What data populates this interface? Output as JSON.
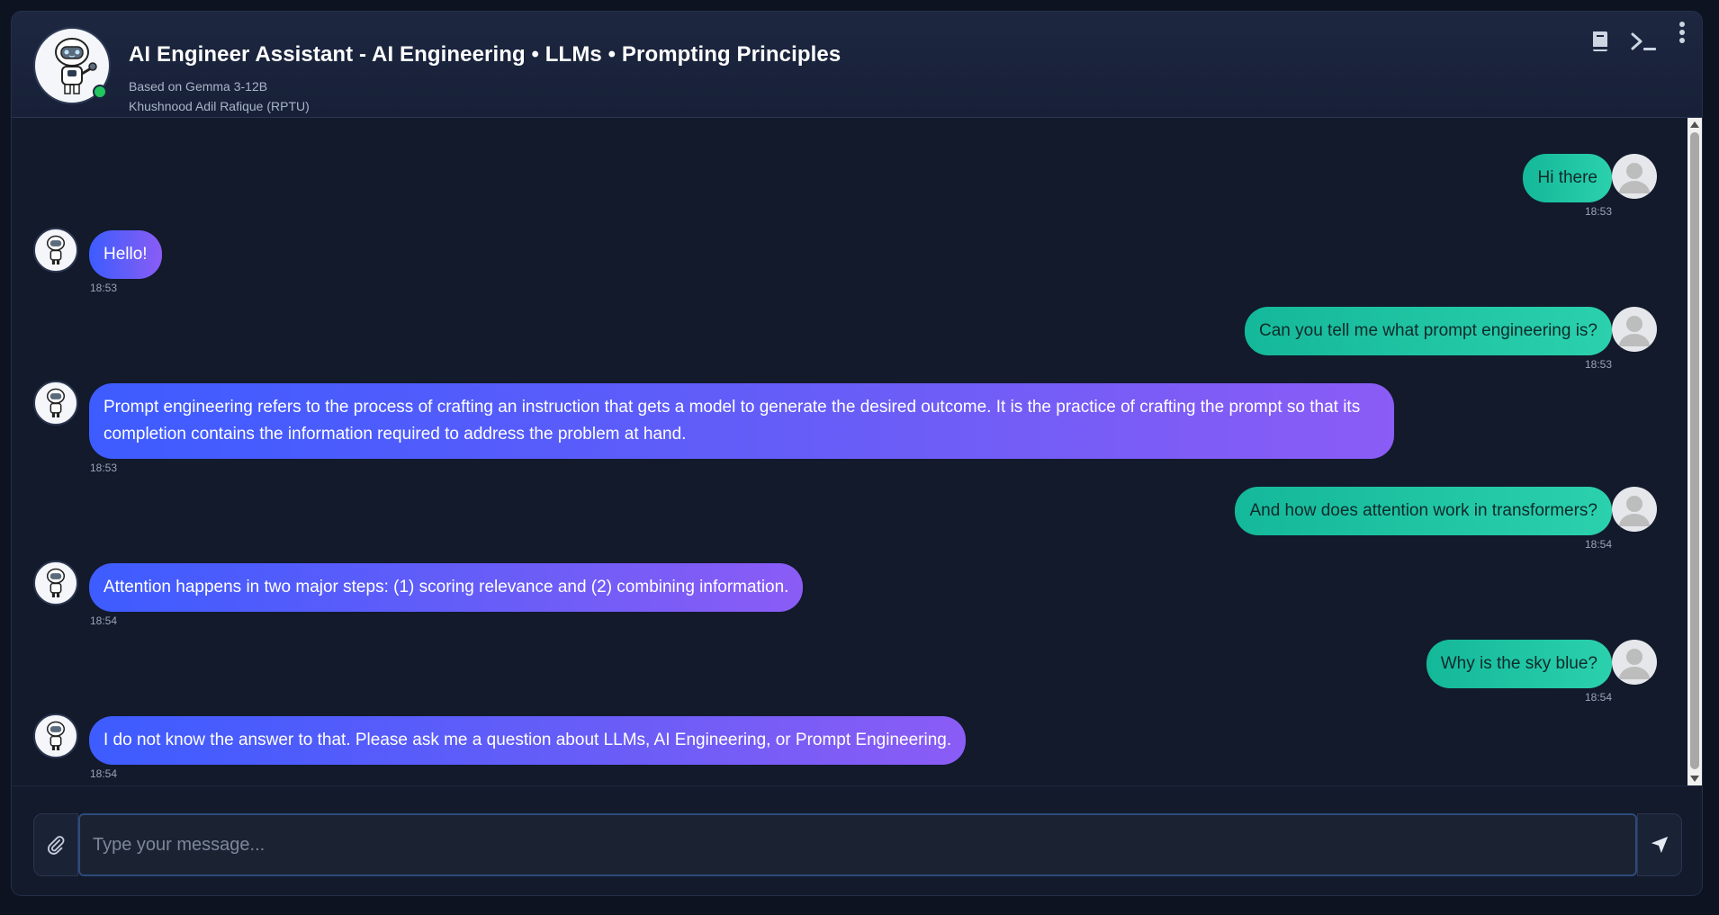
{
  "header": {
    "title": "AI Engineer Assistant - AI Engineering • LLMs • Prompting Principles",
    "model": "Based on Gemma 3-12B",
    "author": "Khushnood Adil Rafique (RPTU)",
    "status": "online",
    "icons": [
      "book-icon",
      "terminal-icon",
      "more-vertical-icon"
    ]
  },
  "messages": [
    {
      "role": "user",
      "text": "Hi there",
      "time": "18:53"
    },
    {
      "role": "bot",
      "text": "Hello!",
      "time": "18:53"
    },
    {
      "role": "user",
      "text": "Can you tell me what prompt engineering is?",
      "time": "18:53"
    },
    {
      "role": "bot",
      "text": "Prompt engineering refers to the process of crafting an instruction that gets a model to generate the desired outcome. It is the practice of crafting the prompt so that its completion contains the information required to address the problem at hand.",
      "time": "18:53"
    },
    {
      "role": "user",
      "text": "And how does attention work in transformers?",
      "time": "18:54"
    },
    {
      "role": "bot",
      "text": "Attention happens in two major steps: (1) scoring relevance and (2) combining information.",
      "time": "18:54"
    },
    {
      "role": "user",
      "text": "Why is the sky blue?",
      "time": "18:54"
    },
    {
      "role": "bot",
      "text": "I do not know the answer to that. Please ask me a question about LLMs, AI Engineering, or Prompt Engineering.",
      "time": "18:54"
    }
  ],
  "input": {
    "placeholder": "Type your message...",
    "value": ""
  },
  "colors": {
    "user_bubble": "#14b89a",
    "bot_bubble_start": "#3d5cff",
    "bot_bubble_end": "#8b5cf6",
    "background": "#121a2b"
  }
}
